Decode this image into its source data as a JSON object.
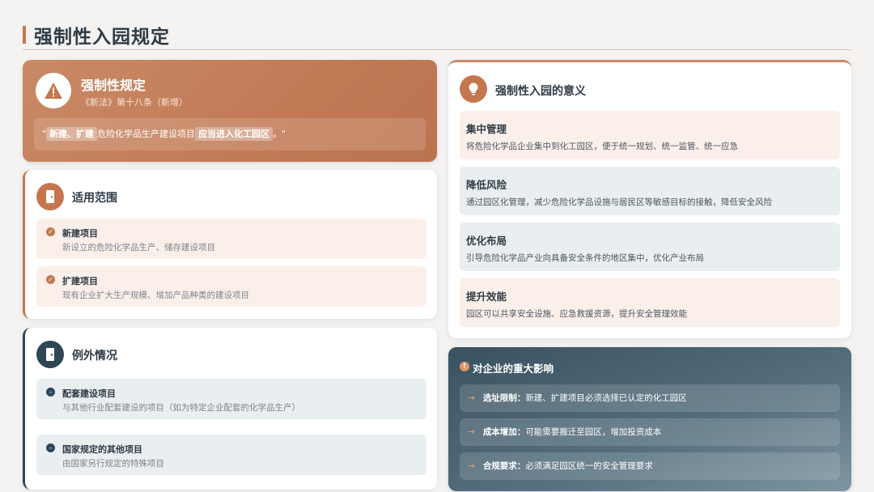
{
  "page": {
    "title": "强制性入园规定"
  },
  "colors": {
    "accent": "#c4774f",
    "dark": "#2f4655",
    "warm_bg": "#fbefe9",
    "cool_bg": "#e9eef1"
  },
  "rule": {
    "icon": "warning-icon",
    "title": "强制性规定",
    "subtitle": "《新法》第十八条（新增）",
    "quote_open": "\"",
    "quote_hl1": "新建、扩建",
    "quote_mid": "危险化学品生产建设项目",
    "quote_hl2": "应当进入化工园区",
    "quote_close": "。\""
  },
  "scope": {
    "icon": "door-icon",
    "title": "适用范围",
    "items": [
      {
        "title": "新建项目",
        "desc": "新设立的危险化学品生产、储存建设项目"
      },
      {
        "title": "扩建项目",
        "desc": "现有企业扩大生产规模、增加产品种类的建设项目"
      }
    ]
  },
  "exceptions": {
    "icon": "exit-door-icon",
    "title": "例外情况",
    "items": [
      {
        "title": "配套建设项目",
        "desc": "与其他行业配套建设的项目（如为特定企业配套的化学品生产）"
      },
      {
        "title": "国家规定的其他项目",
        "desc": "由国家另行规定的特殊项目"
      }
    ]
  },
  "meaning": {
    "icon": "lightbulb-icon",
    "title": "强制性入园的意义",
    "items": [
      {
        "title": "集中管理",
        "desc": "将危险化学品企业集中到化工园区，便于统一规划、统一监管、统一应急"
      },
      {
        "title": "降低风险",
        "desc": "通过园区化管理，减少危险化学品设施与居民区等敏感目标的接触，降低安全风险"
      },
      {
        "title": "优化布局",
        "desc": "引导危险化学品产业向具备安全条件的地区集中，优化产业布局"
      },
      {
        "title": "提升效能",
        "desc": "园区可以共享安全设施、应急救援资源，提升安全管理效能"
      }
    ]
  },
  "impact": {
    "icon": "alert-dot-icon",
    "title": "对企业的重大影响",
    "arrow": "→",
    "items": [
      {
        "label": "选址限制：",
        "text": "新建、扩建项目必须选择已认定的化工园区"
      },
      {
        "label": "成本增加：",
        "text": "可能需要搬迁至园区，增加投资成本"
      },
      {
        "label": "合规要求：",
        "text": "必须满足园区统一的安全管理要求"
      }
    ]
  }
}
